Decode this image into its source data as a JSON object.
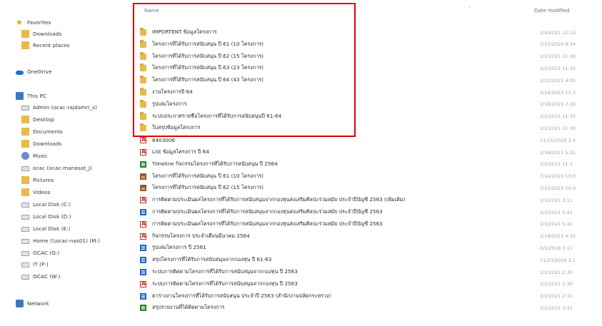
{
  "nav": {
    "items": [
      {
        "label": "Favorites",
        "icon": "star-icon"
      },
      {
        "label": "Downloads",
        "icon": "downloads-folder-icon"
      },
      {
        "label": "Recent places",
        "icon": "recent-places-icon"
      },
      {
        "label": "OneDrive",
        "icon": "onedrive-cloud-icon"
      },
      {
        "label": "This PC",
        "icon": "computer-icon"
      },
      {
        "label": "Admin (ocac-rajdamri_s)",
        "icon": "network-drive-icon"
      },
      {
        "label": "Desktop",
        "icon": "desktop-folder-icon"
      },
      {
        "label": "Documents",
        "icon": "documents-folder-icon"
      },
      {
        "label": "Downloads",
        "icon": "downloads-folder-icon"
      },
      {
        "label": "Music",
        "icon": "music-folder-icon"
      },
      {
        "label": "ocac (ocac-manasat_j)",
        "icon": "network-drive-icon"
      },
      {
        "label": "Pictures",
        "icon": "pictures-folder-icon"
      },
      {
        "label": "Videos",
        "icon": "videos-folder-icon"
      },
      {
        "label": "Local Disk (C:)",
        "icon": "local-disk-icon"
      },
      {
        "label": "Local Disk (D:)",
        "icon": "local-disk-icon"
      },
      {
        "label": "Local Disk (E:)",
        "icon": "local-disk-icon"
      },
      {
        "label": "Home (\\\\ocac-nas01) (M:)",
        "icon": "network-drive-icon"
      },
      {
        "label": "OCAC (O:)",
        "icon": "network-drive-icon"
      },
      {
        "label": "IT (P:)",
        "icon": "network-drive-icon"
      },
      {
        "label": "OCAC (W:)",
        "icon": "network-drive-icon"
      },
      {
        "label": "Network",
        "icon": "network-icon"
      }
    ]
  },
  "list": {
    "name_header": "Name",
    "date_header": "Date modified",
    "rows": [
      {
        "name": "IMPORTENT ข้อมูลโครงการ",
        "date": "2/4/2021 12:13",
        "type": "folder"
      },
      {
        "name": "โครงการที่ได้รับการสนับสนุน ปี 61 (10 โครงการ)",
        "date": "7/15/2020 9:34",
        "type": "folder"
      },
      {
        "name": "โครงการที่ได้รับการสนับสนุน ปี 62 (15 โครงการ)",
        "date": "2/2/2021 11:30",
        "type": "folder"
      },
      {
        "name": "โครงการที่ได้รับการสนับสนุน ปี 63 (23 โครงการ)",
        "date": "2/2/2021 11:32",
        "type": "folder"
      },
      {
        "name": "โครงการที่ได้รับการสนับสนุน ปี 64 (43 โครงการ)",
        "date": "2/22/2021 4:05",
        "type": "folder"
      },
      {
        "name": "งานโครงการปี 64",
        "date": "2/18/2021 12:3",
        "type": "folder"
      },
      {
        "name": "รูปเล่มโครงการ",
        "date": "2/18/2021 2:26",
        "type": "folder"
      },
      {
        "name": "ระบบประกาศรายชื่อโครงการที่ได้รับการสนับสนุนปี 61-64",
        "date": "2/2/2021 11:30",
        "type": "folder"
      },
      {
        "name": "ใบสรุปข้อมูลโครงการ",
        "date": "2/2/2021 11:30",
        "type": "folder"
      },
      {
        "name": "6403006",
        "date": "11/15/2020 3:4",
        "type": "pdf"
      },
      {
        "name": "List ข้อมูลโครงการ ปี 64",
        "date": "2/18/2021 5:31",
        "type": "pdf"
      },
      {
        "name": "Timeline กิจกรรมโครงการที่ได้รับการสนับสนุน ปี 2564",
        "date": "2/2/2021 11:3",
        "type": "xls"
      },
      {
        "name": "โครงการที่ได้รับการสนับสนุน ปี 61 (10 โครงการ)",
        "date": "7/14/2020 10:0",
        "type": "img"
      },
      {
        "name": "โครงการที่ได้รับการสนับสนุน ปี 62 (15 โครงการ)",
        "date": "7/15/2020 10:0",
        "type": "img"
      },
      {
        "name": "การติดตามประเมินผลโครงการที่ได้รับการสนับสนุนจากกองทุนส่งเสริมศิลปะร่วมสมัย ประจำปีบัญชี 2563 (เพิ่มเติม)",
        "date": "2/3/2021 3:11",
        "type": "pdf"
      },
      {
        "name": "การติดตามประเมินผลโครงการที่ได้รับการสนับสนุนจากกองทุนส่งเสริมศิลปะร่วมสมัย ประจำปีบัญชี 2563",
        "date": "2/3/2021 5:41",
        "type": "doc"
      },
      {
        "name": "การติดตามประเมินผลโครงการที่ได้รับการสนับสนุนจากกองทุนส่งเสริมศิลปะร่วมสมัย ประจำปีบัญชี 2563",
        "date": "2/3/2021 5:41",
        "type": "pdf"
      },
      {
        "name": "กิจกรรมโครงการ ประจำเดือนมีนาคม 2564",
        "date": "2/18/2021 4:35",
        "type": "pdf"
      },
      {
        "name": "รูปเล่มโครงการ ปี 2561",
        "date": "6/5/2018 3:11",
        "type": "doc"
      },
      {
        "name": "สรุปโครงการที่ได้รับการสนับสนุนจากกองทุน ปี 61-63",
        "date": "11/23/2020 3:1",
        "type": "doc"
      },
      {
        "name": "ระบบการติดตามโครงการที่ได้รับการสนับสนุนจากกองทุน ปี 2563",
        "date": "2/2/2021 2:30",
        "type": "doc"
      },
      {
        "name": "ระบบการติดตามโครงการที่ได้รับการสนับสนุนจากกองทุน ปี 2563",
        "date": "2/2/2021 2:30",
        "type": "pdf"
      },
      {
        "name": "ตารางงานโครงการที่ได้รับการสนับสนุน ประจำปี 2563 (สำนักงานปลัดกระทรวง)",
        "date": "2/2/2021 2:31",
        "type": "doc"
      },
      {
        "name": "สรุปรายงานที่ได้ติดตามโครงการ",
        "date": "2/2/2021 3:31",
        "type": "xls"
      }
    ]
  },
  "colors": {
    "highlight": "#e00000",
    "folder": "#e9b949",
    "pdf": "#c62828",
    "xls": "#2e7d32",
    "doc": "#1e63c7"
  }
}
